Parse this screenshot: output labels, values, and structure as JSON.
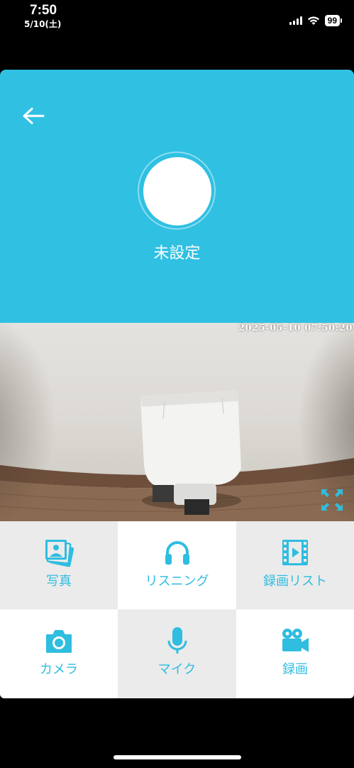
{
  "status_bar": {
    "time": "7:50",
    "date": "5/10(土)",
    "battery": "99"
  },
  "header": {
    "device_name": "未設定",
    "background_color": "#2fc0e2"
  },
  "camera": {
    "timestamp": "2025-05-10 07:50:20"
  },
  "actions": [
    {
      "label": "写真",
      "icon": "photos-icon"
    },
    {
      "label": "リスニング",
      "icon": "headphones-icon"
    },
    {
      "label": "録画リスト",
      "icon": "video-list-icon"
    },
    {
      "label": "カメラ",
      "icon": "camera-icon"
    },
    {
      "label": "マイク",
      "icon": "microphone-icon"
    },
    {
      "label": "録画",
      "icon": "video-camera-icon"
    }
  ],
  "colors": {
    "accent": "#2fbde0",
    "tile_gray": "#ebebeb",
    "tile_white": "#ffffff"
  }
}
